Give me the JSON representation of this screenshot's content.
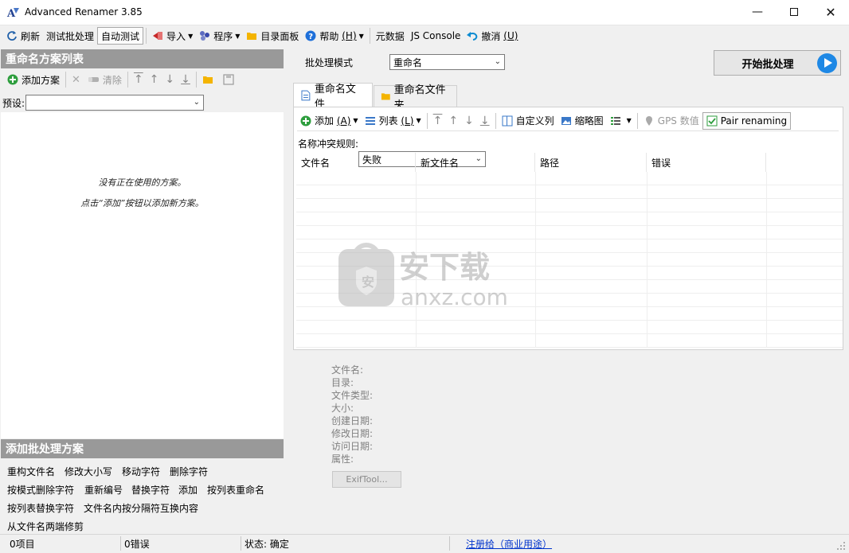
{
  "window": {
    "title": "Advanced Renamer 3.85"
  },
  "toolbar": {
    "refresh": "刷新",
    "test_batch": "测试批处理",
    "auto_test": "自动测试",
    "import": "导入",
    "program": "程序",
    "directory_panel": "目录面板",
    "help": "帮助",
    "help_key": "(H)",
    "metadata": "元数据",
    "js_console": "JS Console",
    "undo": "撤消",
    "undo_key": "(U)"
  },
  "left_panel": {
    "title": "重命名方案列表",
    "add_method": "添加方案",
    "clear": "清除",
    "preset_label": "预设:",
    "preset_value": "",
    "empty_line1": "没有正在使用的方案。",
    "empty_line2": "点击“添加”按钮以添加新方案。"
  },
  "add_methods": {
    "title": "添加批处理方案",
    "items": [
      "重构文件名",
      "修改大小写",
      "移动字符",
      "删除字符",
      "按模式删除字符",
      "重新编号",
      "替换字符",
      "添加",
      "按列表重命名",
      "按列表替换字符",
      "文件名内按分隔符互换内容",
      "从文件名两端修剪"
    ]
  },
  "batch": {
    "label": "批处理模式",
    "value": "重命名",
    "start_button": "开始批处理"
  },
  "tabs": {
    "files": "重命名文件",
    "folders": "重命名文件夹"
  },
  "files_toolbar": {
    "add": "添加",
    "add_key": "(A)",
    "list": "列表",
    "list_key": "(L)",
    "custom_columns": "自定义列",
    "thumbnails": "缩略图",
    "gps": "GPS 数值",
    "pair_renaming": "Pair renaming"
  },
  "conflict": {
    "label": "名称冲突规则:",
    "value": "失败"
  },
  "columns": [
    "文件名",
    "新文件名",
    "路径",
    "错误"
  ],
  "info": {
    "fields": [
      "文件名:",
      "目录:",
      "文件类型:",
      "大小:",
      "创建日期:",
      "修改日期:",
      "访问日期:",
      "属性:"
    ],
    "exif_button": "ExifTool..."
  },
  "watermark": {
    "cn": "安下载",
    "en": "anxz.com"
  },
  "status": {
    "items": "0项目",
    "errors": "0错误",
    "state": "状态: 确定",
    "register": "注册给（商业用途）"
  },
  "colors": {
    "panel_header": "#999999",
    "accent_blue": "#1e88e5",
    "link": "#0033cc"
  }
}
